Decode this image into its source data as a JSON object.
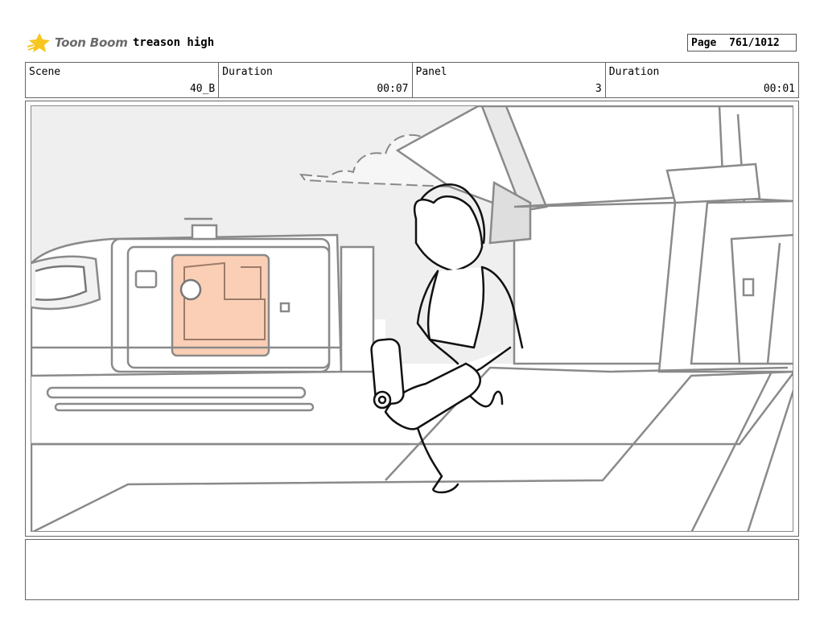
{
  "header": {
    "logo_text": "Toon Boom",
    "project_title": "treason high",
    "page_label": "Page",
    "page_value": "761/1012"
  },
  "info": {
    "scene_label": "Scene",
    "scene_value": "40_B",
    "scene_duration_label": "Duration",
    "scene_duration_value": "00:07",
    "panel_label": "Panel",
    "panel_value": "3",
    "panel_duration_label": "Duration",
    "panel_duration_value": "00:01"
  },
  "colors": {
    "sky": "#efefef",
    "line_gray": "#8a8a8a",
    "window_highlight": "#fbcfb5",
    "logo_yellow": "#f7c620"
  }
}
